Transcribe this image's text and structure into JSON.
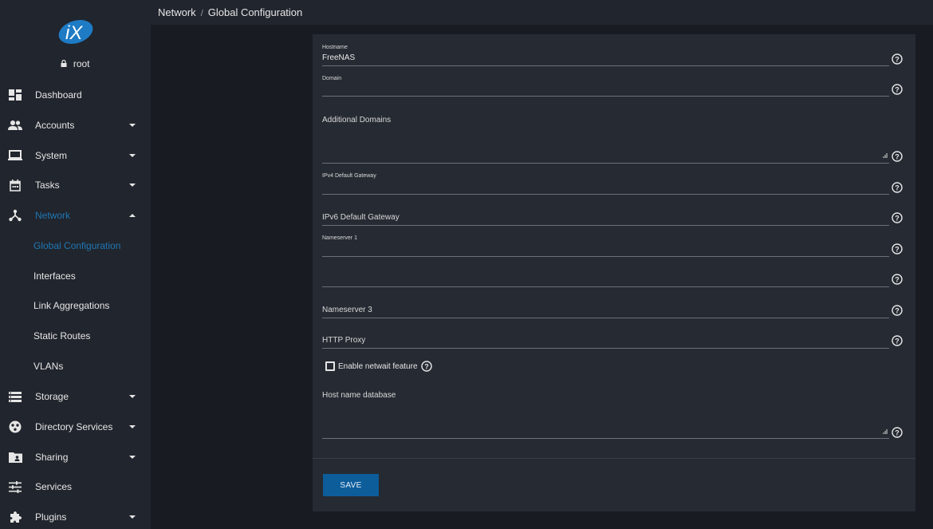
{
  "user": {
    "name": "root"
  },
  "breadcrumb": {
    "parent": "Network",
    "separator": "/",
    "current": "Global Configuration"
  },
  "nav": {
    "items": [
      {
        "label": "Dashboard",
        "icon": "dashboard-icon"
      },
      {
        "label": "Accounts",
        "icon": "accounts-icon"
      },
      {
        "label": "System",
        "icon": "system-icon"
      },
      {
        "label": "Tasks",
        "icon": "tasks-icon"
      },
      {
        "label": "Network",
        "icon": "network-icon"
      },
      {
        "label": "Storage",
        "icon": "storage-icon"
      },
      {
        "label": "Directory Services",
        "icon": "directory-services-icon"
      },
      {
        "label": "Sharing",
        "icon": "sharing-icon"
      },
      {
        "label": "Services",
        "icon": "services-icon"
      },
      {
        "label": "Plugins",
        "icon": "plugins-icon"
      }
    ],
    "network_sub": [
      {
        "label": "Global Configuration"
      },
      {
        "label": "Interfaces"
      },
      {
        "label": "Link Aggregations"
      },
      {
        "label": "Static Routes"
      },
      {
        "label": "VLANs"
      }
    ]
  },
  "form": {
    "hostname": {
      "label": "Hostname",
      "value": "FreeNAS"
    },
    "domain": {
      "label": "Domain",
      "value": ""
    },
    "additional_domains": {
      "label": "Additional Domains",
      "value": ""
    },
    "ipv4_gateway": {
      "label": "IPv4 Default Gateway",
      "value": ""
    },
    "ipv6_gateway": {
      "label": "IPv6 Default Gateway",
      "value": ""
    },
    "nameserver1": {
      "label": "Nameserver 1",
      "value": ""
    },
    "nameserver2": {
      "label": "",
      "value": ""
    },
    "nameserver3": {
      "label": "Nameserver 3",
      "value": ""
    },
    "http_proxy": {
      "label": "HTTP Proxy",
      "value": ""
    },
    "netwait": {
      "label": "Enable netwait feature",
      "checked": false
    },
    "hosts_db": {
      "label": "Host name database",
      "value": ""
    },
    "save_label": "SAVE"
  },
  "colors": {
    "accent": "#1f77b4",
    "save_button": "#0d5d9b",
    "sidebar": "#21252d",
    "background": "#181b21",
    "card": "#262b33"
  }
}
